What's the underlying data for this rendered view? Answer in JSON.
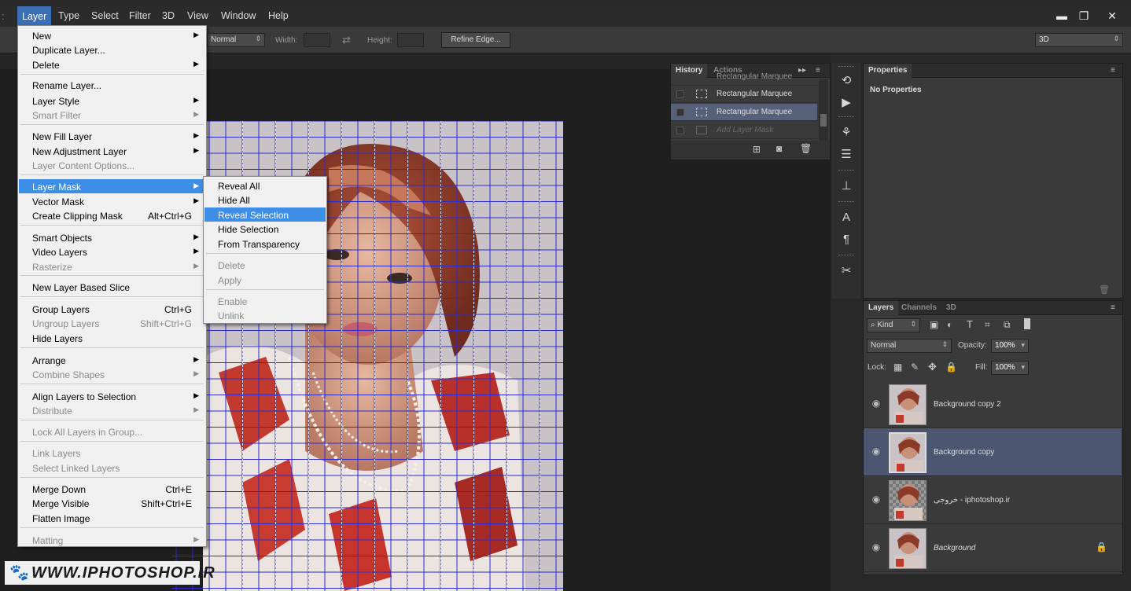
{
  "menubar": {
    "items": [
      "Layer",
      "Type",
      "Select",
      "Filter",
      "3D",
      "View",
      "Window",
      "Help"
    ],
    "window_controls": {
      "minimize": "▬",
      "restore": "❐",
      "close": "✕"
    }
  },
  "options_bar": {
    "mode": "Normal",
    "width_label": "Width:",
    "height_label": "Height:",
    "refine_edge": "Refine Edge...",
    "workspace": "3D"
  },
  "layer_menu": {
    "items": [
      {
        "label": "New",
        "submenu": true
      },
      {
        "label": "Duplicate Layer..."
      },
      {
        "label": "Delete",
        "submenu": true
      },
      {
        "label": "Rename Layer..."
      },
      {
        "label": "Layer Style",
        "submenu": true
      },
      {
        "label": "Smart Filter",
        "submenu": true,
        "disabled": true
      },
      {
        "label": "New Fill Layer",
        "submenu": true
      },
      {
        "label": "New Adjustment Layer",
        "submenu": true
      },
      {
        "label": "Layer Content Options...",
        "disabled": true
      },
      {
        "label": "Layer Mask",
        "submenu": true,
        "highlighted": true
      },
      {
        "label": "Vector Mask",
        "submenu": true
      },
      {
        "label": "Create Clipping Mask",
        "shortcut": "Alt+Ctrl+G"
      },
      {
        "label": "Smart Objects",
        "submenu": true
      },
      {
        "label": "Video Layers",
        "submenu": true
      },
      {
        "label": "Rasterize",
        "submenu": true,
        "disabled": true
      },
      {
        "label": "New Layer Based Slice"
      },
      {
        "label": "Group Layers",
        "shortcut": "Ctrl+G"
      },
      {
        "label": "Ungroup Layers",
        "shortcut": "Shift+Ctrl+G",
        "disabled": true
      },
      {
        "label": "Hide Layers"
      },
      {
        "label": "Arrange",
        "submenu": true
      },
      {
        "label": "Combine Shapes",
        "submenu": true,
        "disabled": true
      },
      {
        "label": "Align Layers to Selection",
        "submenu": true
      },
      {
        "label": "Distribute",
        "submenu": true,
        "disabled": true
      },
      {
        "label": "Lock All Layers in Group...",
        "disabled": true
      },
      {
        "label": "Link Layers",
        "disabled": true
      },
      {
        "label": "Select Linked Layers",
        "disabled": true
      },
      {
        "label": "Merge Down",
        "shortcut": "Ctrl+E"
      },
      {
        "label": "Merge Visible",
        "shortcut": "Shift+Ctrl+E"
      },
      {
        "label": "Flatten Image"
      },
      {
        "label": "Matting",
        "submenu": true,
        "disabled": true
      }
    ]
  },
  "layer_mask_submenu": {
    "items": [
      {
        "label": "Reveal All"
      },
      {
        "label": "Hide All"
      },
      {
        "label": "Reveal Selection",
        "highlighted": true
      },
      {
        "label": "Hide Selection"
      },
      {
        "label": "From Transparency"
      },
      {
        "label": "Delete",
        "disabled": true
      },
      {
        "label": "Apply",
        "disabled": true
      },
      {
        "label": "Enable",
        "disabled": true
      },
      {
        "label": "Unlink",
        "disabled": true
      }
    ]
  },
  "history_panel": {
    "tabs": [
      "History",
      "Actions"
    ],
    "rows": [
      {
        "label": "Rectangular Marquee",
        "partial": true
      },
      {
        "label": "Rectangular Marquee"
      },
      {
        "label": "Rectangular Marquee",
        "selected": true
      },
      {
        "label": "Add Layer Mask",
        "inactive": true
      }
    ]
  },
  "properties_panel": {
    "title": "Properties",
    "empty_text": "No Properties"
  },
  "layers_panel": {
    "tabs": [
      "Layers",
      "Channels",
      "3D"
    ],
    "filter_kind": "Kind",
    "blend_mode": "Normal",
    "opacity_label": "Opacity:",
    "opacity_value": "100%",
    "lock_label": "Lock:",
    "fill_label": "Fill:",
    "fill_value": "100%",
    "layers": [
      {
        "name": "Background copy 2"
      },
      {
        "name": "Background copy",
        "selected": true
      },
      {
        "name": "خروجی - iphotoshop.ir"
      },
      {
        "name": "Background",
        "locked": true
      }
    ]
  },
  "watermark": "WWW.IPHOTOSHOP.IR",
  "colors": {
    "menu_highlight": "#3d8ee6",
    "grid_line": "#2b2bd0",
    "selected_layer": "#4c5670"
  }
}
